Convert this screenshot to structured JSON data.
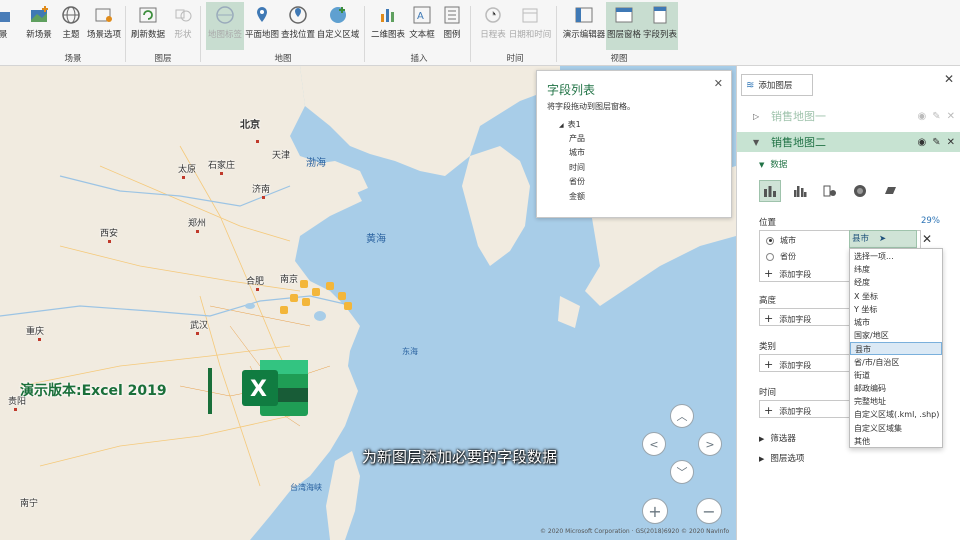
{
  "ribbon": {
    "buttons": [
      {
        "label": "场景"
      },
      {
        "label": "新场景"
      },
      {
        "label": "主题"
      },
      {
        "label": "场景选项"
      },
      {
        "label": "刷新数据"
      },
      {
        "label": "形状"
      },
      {
        "label": "地图标签"
      },
      {
        "label": "平面地图"
      },
      {
        "label": "查找位置"
      },
      {
        "label": "自定义区域"
      },
      {
        "label": "二维图表"
      },
      {
        "label": "文本框"
      },
      {
        "label": "图例"
      },
      {
        "label": "日程表"
      },
      {
        "label": "日期和时间"
      },
      {
        "label": "演示编辑器"
      },
      {
        "label": "图层窗格"
      },
      {
        "label": "字段列表"
      }
    ],
    "groups": [
      {
        "label": "场景"
      },
      {
        "label": "图层"
      },
      {
        "label": "地图"
      },
      {
        "label": "插入"
      },
      {
        "label": "时间"
      },
      {
        "label": "视图"
      }
    ]
  },
  "map": {
    "cities": [
      {
        "label": "北京"
      },
      {
        "label": "天津"
      },
      {
        "label": "太原"
      },
      {
        "label": "石家庄"
      },
      {
        "label": "济南"
      },
      {
        "label": "郑州"
      },
      {
        "label": "西安"
      },
      {
        "label": "合肥"
      },
      {
        "label": "南京"
      },
      {
        "label": "武汉"
      },
      {
        "label": "重庆"
      },
      {
        "label": "贵阳"
      },
      {
        "label": "南宁"
      }
    ],
    "seas": [
      {
        "label": "渤海"
      },
      {
        "label": "黄海"
      },
      {
        "label": "东海"
      },
      {
        "label": "台湾海峡"
      }
    ],
    "field_popup": {
      "title": "字段列表",
      "description": "将字段拖动到图层窗格。",
      "table": "表1",
      "fields": [
        "产品",
        "城市",
        "时间",
        "省份",
        "金额"
      ]
    },
    "version_text": "演示版本:Excel 2019",
    "excel_letter": "X",
    "subtitle": "为新图层添加必要的字段数据",
    "copyright": "© 2020 Microsoft Corporation · GS(2018)6920 © 2020 NavInfo"
  },
  "panel": {
    "add_layer": "添加图层",
    "layers": [
      {
        "name": "销售地图一",
        "selected": false
      },
      {
        "name": "销售地图二",
        "selected": true
      }
    ],
    "data_section": "数据",
    "location": {
      "label": "位置",
      "percent": "29%",
      "fields": [
        "城市",
        "省份"
      ],
      "selected_geo": "县市",
      "add_field": "添加字段"
    },
    "dropdown_items": [
      "选择一项...",
      "纬度",
      "经度",
      "X 坐标",
      "Y 坐标",
      "城市",
      "国家/地区",
      "县市",
      "省/市/自治区",
      "街道",
      "邮政编码",
      "完整地址",
      "自定义区域(.kml, .shp)",
      "自定义区域集",
      "其他"
    ],
    "dropdown_highlight": "县市",
    "height": {
      "label": "高度",
      "add_field": "添加字段"
    },
    "category": {
      "label": "类别",
      "add_field": "添加字段"
    },
    "time": {
      "label": "时间",
      "add_field": "添加字段"
    },
    "filters": "筛选器",
    "layer_options": "图层选项"
  },
  "colors": {
    "accent": "#217346",
    "land": "#f1ebe0",
    "sea": "#a8cde8"
  }
}
